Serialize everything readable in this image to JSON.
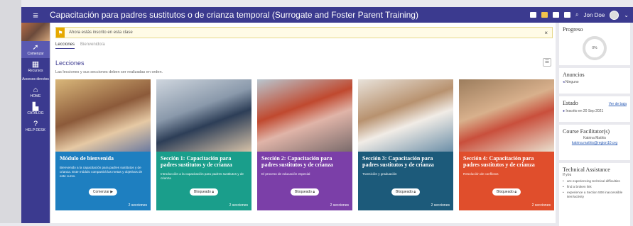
{
  "header": {
    "title": "Capacitación para padres sustitutos o de crianza temporal (Surrogate and Foster Parent Training)",
    "user_name": "Jon Doe"
  },
  "sidebar": {
    "items": [
      {
        "label": "Comenzar",
        "icon": "rocket-icon"
      },
      {
        "label": "Recursos",
        "icon": "folder-icon"
      },
      {
        "label": "Accesos directos",
        "icon": ""
      },
      {
        "label": "HOME",
        "icon": "home-icon"
      },
      {
        "label": "CATALOG",
        "icon": "catalog-icon"
      },
      {
        "label": "HELP DESK",
        "icon": "help-icon"
      }
    ]
  },
  "enrollment": {
    "message": "Ahora estás inscrito en esta clase"
  },
  "tabs": [
    "Lecciones",
    "Bienvenido/a"
  ],
  "lessons": {
    "heading": "Lecciones",
    "subtitle": "Las lecciones y sus secciones deben ser realizadas en orden.",
    "cards": [
      {
        "title": "Módulo de bienvenida",
        "desc": "Bienvenido a la capacitación para padres sustitutos y de crianza. Este módulo compartirá las metas y objetivos de este curso.",
        "button": "Comenzar",
        "count": "2 secciones",
        "color": "#1e7fc0"
      },
      {
        "title": "Sección 1: Capacitación para padres sustitutos y de crianza",
        "desc": "Introducción a la capacitación para padres sustitutos y de crianza",
        "button": "Bloqueado",
        "count": "2 secciones",
        "color": "#1a9e8b"
      },
      {
        "title": "Sección 2: Capacitación para padres sustitutos y de crianza",
        "desc": "El proceso de educación especial",
        "button": "Bloqueado",
        "count": "2 secciones",
        "color": "#7b3fa8"
      },
      {
        "title": "Sección 3: Capacitación para padres sustitutos y de crianza",
        "desc": "Transición y graduación",
        "button": "Bloqueado",
        "count": "2 secciones",
        "color": "#1c5a7a"
      },
      {
        "title": "Sección 4: Capacitación para padres sustitutos y de crianza",
        "desc": "Resolución de conflictos",
        "button": "Bloqueado",
        "count": "2 secciones",
        "color": "#e04e2c"
      }
    ]
  },
  "right": {
    "progress_title": "Progreso",
    "progress_value": "0%",
    "announcements_title": "Anuncios",
    "announcements_value": "Ninguno",
    "status_title": "Estado",
    "status_link": "Ver de baja",
    "status_value": "Inscrito en 20 Sep 2021",
    "facilitator_title": "Course Facilitator(s)",
    "facilitator_name": "Katrina Mathis",
    "facilitator_email": "katrina.mathis@region10.org",
    "ta_title": "Technical Assistance",
    "ta_intro": "If you",
    "ta_items": [
      "are experiencing technical difficulties",
      "find a broken link",
      "experience a Section 508 inaccessible item/activity"
    ]
  }
}
